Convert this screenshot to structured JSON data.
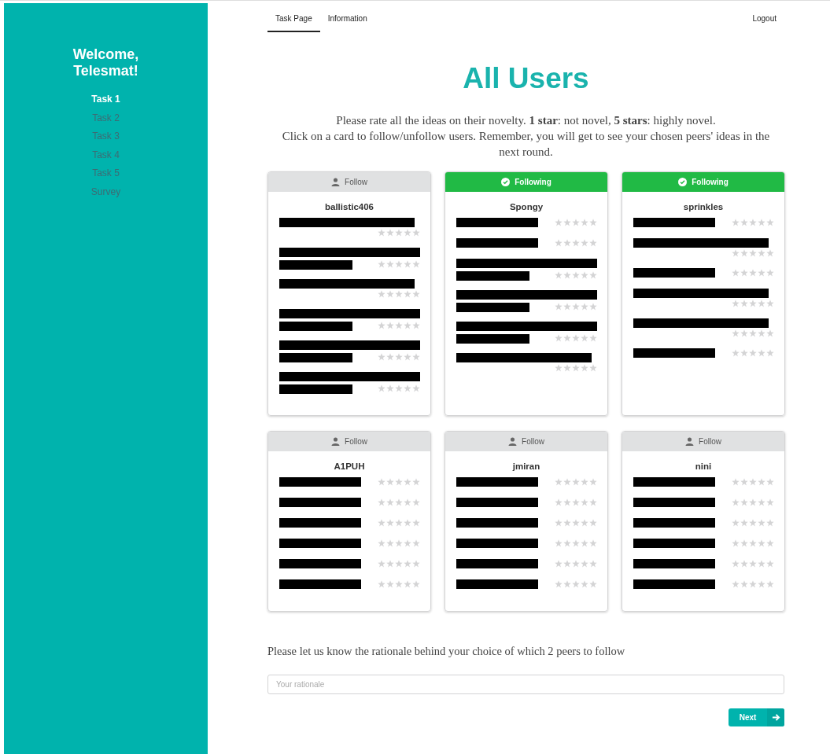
{
  "sidebar": {
    "greeting": "Welcome, Telesmat!",
    "items": [
      {
        "label": "Task 1",
        "selected": true
      },
      {
        "label": "Task 2",
        "selected": false
      },
      {
        "label": "Task 3",
        "selected": false
      },
      {
        "label": "Task 4",
        "selected": false
      },
      {
        "label": "Task 5",
        "selected": false
      },
      {
        "label": "Survey",
        "selected": false
      }
    ]
  },
  "tabs": [
    {
      "label": "Task Page",
      "selected": true
    },
    {
      "label": "Information",
      "selected": false
    }
  ],
  "logout": "Logout",
  "title": "All Users",
  "instructions": [
    "Please rate all the ideas on their novelty. **1 star**: not novel, **5 stars**: highly novel.",
    "Click on a card to follow/unfollow users. Remember, you will get to see your chosen peers' ideas in the next round."
  ],
  "users": [
    {
      "name": "ballistic406",
      "following": false,
      "button": "Follow",
      "ideas": [
        {
          "kind": "long",
          "stars": 0
        },
        {
          "kind": "wrap",
          "stars": 0
        },
        {
          "kind": "long",
          "stars": 0
        },
        {
          "kind": "wrap",
          "stars": 0
        },
        {
          "kind": "wrap",
          "stars": 0
        },
        {
          "kind": "wrap",
          "stars": 0
        }
      ]
    },
    {
      "name": "Spongy",
      "following": true,
      "button": "Following",
      "ideas": [
        {
          "kind": "short",
          "stars": 0
        },
        {
          "kind": "short",
          "stars": 0
        },
        {
          "kind": "wrap",
          "stars": 0
        },
        {
          "kind": "wrap",
          "stars": 0
        },
        {
          "kind": "wrap",
          "stars": 0
        },
        {
          "kind": "long",
          "stars": 0
        }
      ]
    },
    {
      "name": "sprinkles",
      "following": true,
      "button": "Following",
      "ideas": [
        {
          "kind": "short",
          "stars": 0
        },
        {
          "kind": "long",
          "stars": 0
        },
        {
          "kind": "short",
          "stars": 0
        },
        {
          "kind": "long",
          "stars": 0
        },
        {
          "kind": "long",
          "stars": 0
        },
        {
          "kind": "short",
          "stars": 0
        }
      ]
    },
    {
      "name": "A1PUH",
      "following": false,
      "button": "Follow",
      "ideas": [
        {
          "kind": "short",
          "stars": 0
        },
        {
          "kind": "short",
          "stars": 0
        },
        {
          "kind": "short",
          "stars": 0
        },
        {
          "kind": "short",
          "stars": 0
        },
        {
          "kind": "short",
          "stars": 0
        },
        {
          "kind": "short",
          "stars": 0
        }
      ]
    },
    {
      "name": "jmiran",
      "following": false,
      "button": "Follow",
      "ideas": [
        {
          "kind": "short",
          "stars": 0
        },
        {
          "kind": "short",
          "stars": 0
        },
        {
          "kind": "short",
          "stars": 0
        },
        {
          "kind": "short",
          "stars": 0
        },
        {
          "kind": "short",
          "stars": 0
        },
        {
          "kind": "short",
          "stars": 0
        }
      ]
    },
    {
      "name": "nini",
      "following": false,
      "button": "Follow",
      "ideas": [
        {
          "kind": "short",
          "stars": 0
        },
        {
          "kind": "short",
          "stars": 0
        },
        {
          "kind": "short",
          "stars": 0
        },
        {
          "kind": "short",
          "stars": 0
        },
        {
          "kind": "short",
          "stars": 0
        },
        {
          "kind": "short",
          "stars": 0
        }
      ]
    }
  ],
  "rationale": {
    "label": "Please let us know the rationale behind your choice of which 2 peers to follow",
    "placeholder": "Your rationale"
  },
  "next_button": "Next"
}
